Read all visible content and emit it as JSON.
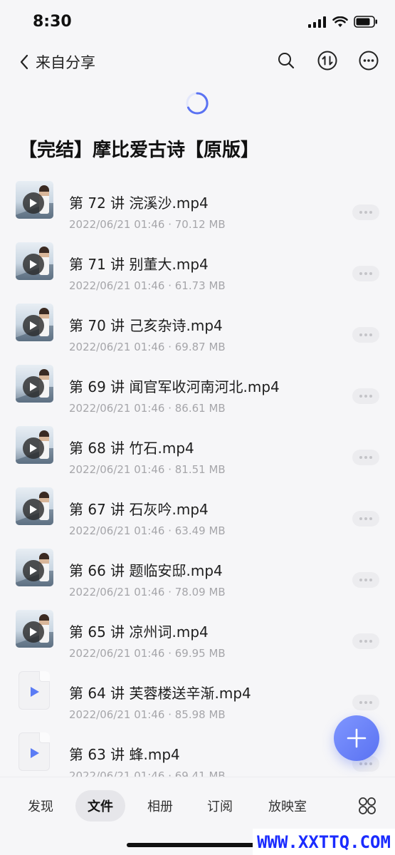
{
  "status_bar": {
    "time": "8:30"
  },
  "nav": {
    "back_label": "来自分享"
  },
  "folder": {
    "title": "【完结】摩比爱古诗【原版】"
  },
  "files": [
    {
      "name": "第 72 讲 浣溪沙.mp4",
      "meta": "2022/06/21 01:46 · 70.12 MB",
      "icon": "video-thumbnail"
    },
    {
      "name": "第 71 讲 别董大.mp4",
      "meta": "2022/06/21 01:46 · 61.73 MB",
      "icon": "video-thumbnail"
    },
    {
      "name": "第 70 讲 己亥杂诗.mp4",
      "meta": "2022/06/21 01:46 · 69.87 MB",
      "icon": "video-thumbnail"
    },
    {
      "name": "第 69 讲 闻官军收河南河北.mp4",
      "meta": "2022/06/21 01:46 · 86.61 MB",
      "icon": "video-thumbnail"
    },
    {
      "name": "第 68 讲 竹石.mp4",
      "meta": "2022/06/21 01:46 · 81.51 MB",
      "icon": "video-thumbnail"
    },
    {
      "name": "第 67 讲 石灰吟.mp4",
      "meta": "2022/06/21 01:46 · 63.49 MB",
      "icon": "video-thumbnail"
    },
    {
      "name": "第 66 讲 题临安邸.mp4",
      "meta": "2022/06/21 01:46 · 78.09 MB",
      "icon": "video-thumbnail"
    },
    {
      "name": "第 65 讲 凉州词.mp4",
      "meta": "2022/06/21 01:46 · 69.95 MB",
      "icon": "video-thumbnail"
    },
    {
      "name": "第 64 讲 芙蓉楼送辛渐.mp4",
      "meta": "2022/06/21 01:46 · 85.98 MB",
      "icon": "video-file-icon"
    },
    {
      "name": "第 63 讲 蜂.mp4",
      "meta": "2022/06/21 01:46 · 69.41 MB",
      "icon": "video-file-icon"
    }
  ],
  "tabs": [
    {
      "label": "发现",
      "active": false
    },
    {
      "label": "文件",
      "active": true
    },
    {
      "label": "相册",
      "active": false
    },
    {
      "label": "订阅",
      "active": false
    },
    {
      "label": "放映室",
      "active": false
    }
  ],
  "watermark": "WWW.XXTTQ.COM",
  "colors": {
    "accent": "#5a72f2",
    "watermark": "#1a2bff"
  }
}
